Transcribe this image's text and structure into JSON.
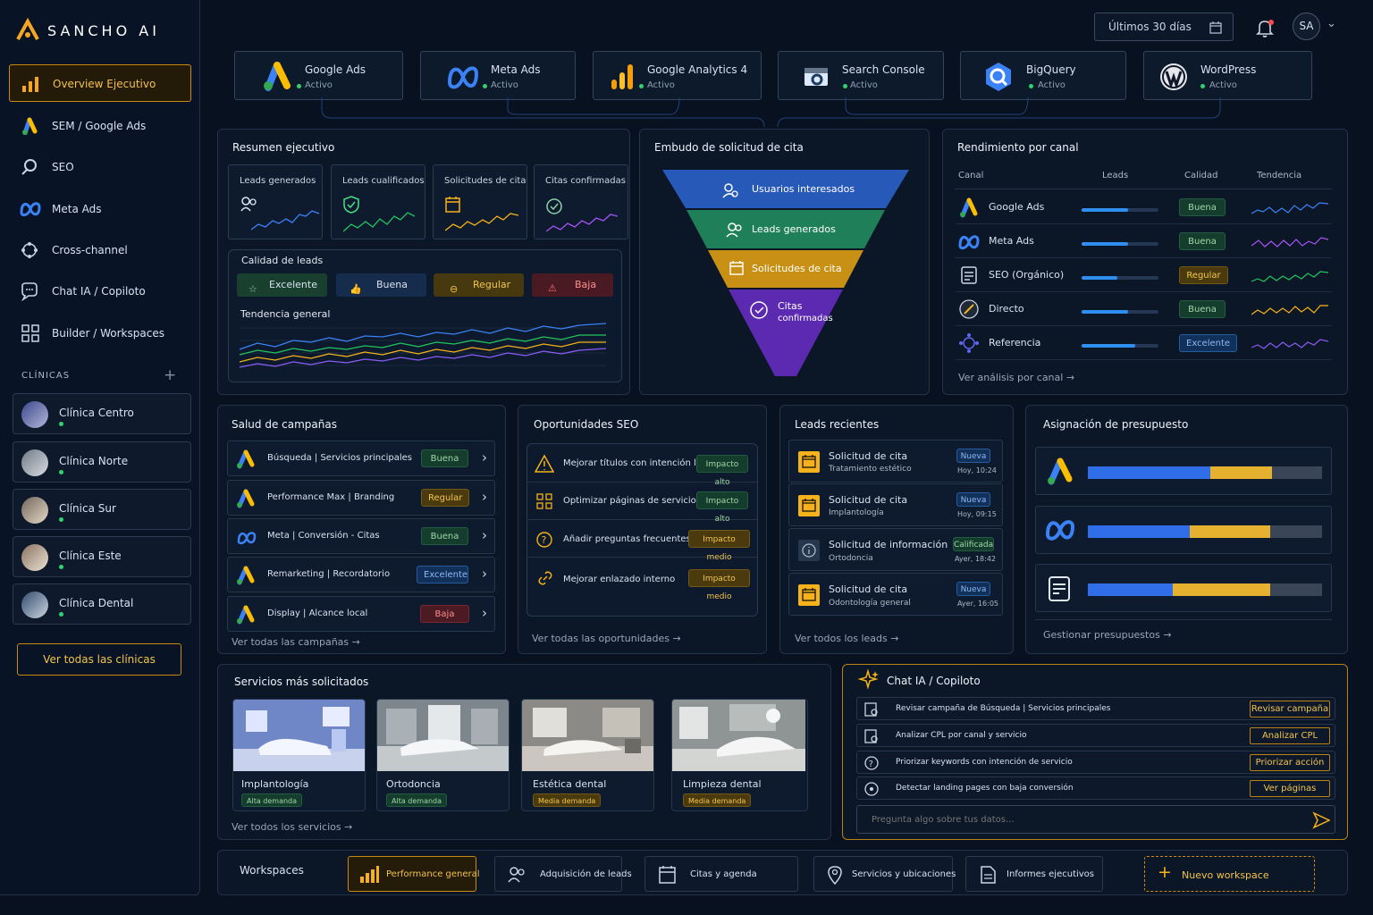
{
  "brand": "SANCHO AI",
  "top": {
    "date_range": "Últimos 30 días",
    "avatar": "SA"
  },
  "sidebar": {
    "items": [
      {
        "label": "Overview Ejecutivo",
        "icon": "bar-chart-icon"
      },
      {
        "label": "SEM / Google Ads",
        "icon": "google-ads-icon"
      },
      {
        "label": "SEO",
        "icon": "search-icon"
      },
      {
        "label": "Meta Ads",
        "icon": "meta-icon"
      },
      {
        "label": "Cross-channel",
        "icon": "network-icon"
      },
      {
        "label": "Chat IA / Copiloto",
        "icon": "chat-icon"
      },
      {
        "label": "Builder / Workspaces",
        "icon": "grid-icon"
      }
    ],
    "clinics_header": "CLÍNICAS",
    "clinics": [
      "Clínica Centro",
      "Clínica Norte",
      "Clínica Sur",
      "Clínica Este",
      "Clínica Dental"
    ],
    "view_all": "Ver todas las clínicas"
  },
  "integrations": [
    {
      "name": "Google Ads",
      "status": "Activo",
      "icon": "google-ads-icon"
    },
    {
      "name": "Meta Ads",
      "status": "Activo",
      "icon": "meta-icon"
    },
    {
      "name": "Google Analytics 4",
      "status": "Activo",
      "icon": "analytics-icon"
    },
    {
      "name": "Search Console",
      "status": "Activo",
      "icon": "search-console-icon"
    },
    {
      "name": "BigQuery",
      "status": "Activo",
      "icon": "bigquery-icon"
    },
    {
      "name": "WordPress",
      "status": "Activo",
      "icon": "wordpress-icon"
    }
  ],
  "summary": {
    "title": "Resumen ejecutivo",
    "metrics": [
      "Leads generados",
      "Leads cualificados",
      "Solicitudes de cita",
      "Citas confirmadas"
    ],
    "quality_title": "Calidad de leads",
    "quality": [
      "Excelente",
      "Buena",
      "Regular",
      "Baja"
    ],
    "trend_title": "Tendencia general"
  },
  "funnel": {
    "title": "Embudo de solicitud de cita",
    "stages": [
      "Usuarios interesados",
      "Leads generados",
      "Solicitudes de cita",
      "Citas",
      "confirmadas"
    ]
  },
  "channels": {
    "title": "Rendimiento por canal",
    "headers": [
      "Canal",
      "Leads",
      "Calidad",
      "Tendencia"
    ],
    "rows": [
      {
        "name": "Google Ads",
        "quality": "Buena",
        "level": 0.6
      },
      {
        "name": "Meta Ads",
        "quality": "Buena",
        "level": 0.6
      },
      {
        "name": "SEO (Orgánico)",
        "quality": "Regular",
        "level": 0.47
      },
      {
        "name": "Directo",
        "quality": "Buena",
        "level": 0.6
      },
      {
        "name": "Referencia",
        "quality": "Excelente",
        "level": 0.7
      }
    ],
    "link": "Ver análisis por canal"
  },
  "campaigns": {
    "title": "Salud de campañas",
    "rows": [
      {
        "name": "Búsqueda | Servicios principales",
        "status": "Buena"
      },
      {
        "name": "Performance Max | Branding",
        "status": "Regular"
      },
      {
        "name": "Meta | Conversión - Citas",
        "status": "Buena"
      },
      {
        "name": "Remarketing | Recordatorio",
        "status": "Excelente"
      },
      {
        "name": "Display | Alcance local",
        "status": "Baja"
      }
    ],
    "link": "Ver todas las campañas"
  },
  "seo": {
    "title": "Oportunidades SEO",
    "rows": [
      {
        "name": "Mejorar títulos con intención local",
        "impact": "Impacto alto"
      },
      {
        "name": "Optimizar páginas de servicios",
        "impact": "Impacto alto"
      },
      {
        "name": "Añadir preguntas frecuentes",
        "impact": "Impacto medio"
      },
      {
        "name": "Mejorar enlazado interno",
        "impact": "Impacto medio"
      }
    ],
    "link": "Ver todas las oportunidades"
  },
  "leads": {
    "title": "Leads recientes",
    "rows": [
      {
        "type": "Solicitud de cita",
        "detail": "Tratamiento estético",
        "badge": "Nueva",
        "time": "Hoy, 10:24"
      },
      {
        "type": "Solicitud de cita",
        "detail": "Implantología",
        "badge": "Nueva",
        "time": "Hoy, 09:15"
      },
      {
        "type": "Solicitud de información",
        "detail": "Ortodoncia",
        "badge": "Calificada",
        "time": "Ayer, 18:42"
      },
      {
        "type": "Solicitud de cita",
        "detail": "Odontología general",
        "badge": "Nueva",
        "time": "Ayer, 16:05"
      }
    ],
    "link": "Ver todos los leads"
  },
  "budget": {
    "title": "Asignación de presupuesto",
    "link": "Gestionar presupuestos"
  },
  "services": {
    "title": "Servicios más solicitados",
    "items": [
      {
        "name": "Implantología",
        "demand": "Alta demanda"
      },
      {
        "name": "Ortodoncia",
        "demand": "Alta demanda"
      },
      {
        "name": "Estética dental",
        "demand": "Media demanda"
      },
      {
        "name": "Limpieza dental",
        "demand": "Media demanda"
      }
    ],
    "link": "Ver todos los servicios"
  },
  "chat": {
    "title": "Chat IA / Copiloto",
    "rows": [
      {
        "text": "Revisar campaña de Búsqueda | Servicios principales",
        "action": "Revisar campaña"
      },
      {
        "text": "Analizar CPL por canal y servicio",
        "action": "Analizar CPL"
      },
      {
        "text": "Priorizar keywords con intención de servicio",
        "action": "Priorizar acción"
      },
      {
        "text": "Detectar landing pages con baja conversión",
        "action": "Ver páginas"
      }
    ],
    "placeholder": "Pregunta algo sobre tus datos..."
  },
  "workspaces": {
    "title": "Workspaces",
    "items": [
      "Performance general",
      "Adquisición de leads",
      "Citas y agenda",
      "Servicios y ubicaciones",
      "Informes ejecutivos"
    ],
    "new": "Nuevo workspace"
  }
}
